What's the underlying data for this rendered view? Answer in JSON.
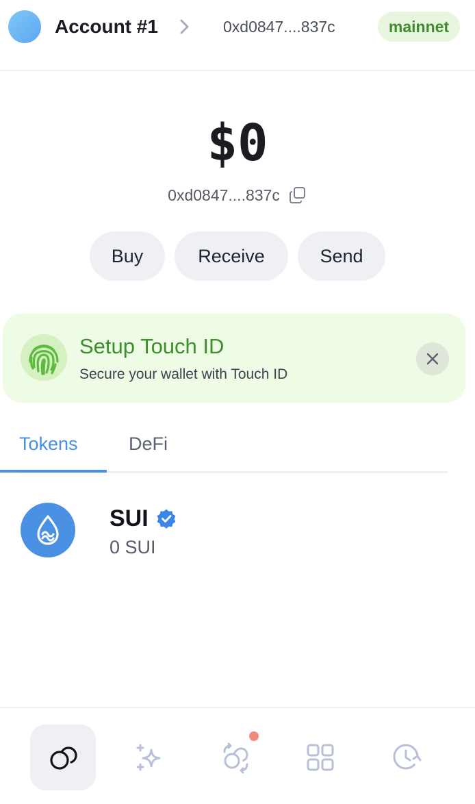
{
  "header": {
    "account_name": "Account #1",
    "address_short": "0xd0847....837c",
    "network": "mainnet",
    "icons": {
      "chevron": "chevron-right-icon"
    }
  },
  "wallet": {
    "balance": "$0",
    "address_short": "0xd0847....837c"
  },
  "actions": {
    "buy_label": "Buy",
    "receive_label": "Receive",
    "send_label": "Send"
  },
  "banner": {
    "title": "Setup Touch ID",
    "subtitle": "Secure your wallet with Touch ID",
    "icon": "fingerprint-icon"
  },
  "tabs": [
    {
      "label": "Tokens",
      "active": true
    },
    {
      "label": "DeFi",
      "active": false
    }
  ],
  "tokens": [
    {
      "name": "SUI",
      "verified": true,
      "balance": "0 SUI"
    }
  ],
  "bottom_nav": [
    {
      "name": "home",
      "icon": "coins-icon",
      "active": true
    },
    {
      "name": "ai",
      "icon": "sparkles-icon",
      "active": false
    },
    {
      "name": "swap",
      "icon": "swap-icon",
      "active": false,
      "has_notification": true
    },
    {
      "name": "apps",
      "icon": "grid-icon",
      "active": false
    },
    {
      "name": "history",
      "icon": "clock-icon",
      "active": false
    }
  ],
  "colors": {
    "accent": "#4a90e2",
    "network_bg": "#e9f6df",
    "network_text": "#3e8c2c",
    "banner_bg": "#eefbe5",
    "notification": "#f08a7e"
  }
}
